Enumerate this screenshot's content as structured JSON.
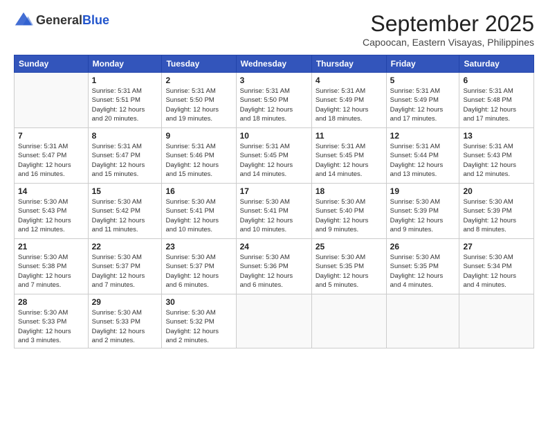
{
  "header": {
    "logo_general": "General",
    "logo_blue": "Blue",
    "month_title": "September 2025",
    "location": "Capoocan, Eastern Visayas, Philippines"
  },
  "days_of_week": [
    "Sunday",
    "Monday",
    "Tuesday",
    "Wednesday",
    "Thursday",
    "Friday",
    "Saturday"
  ],
  "weeks": [
    [
      {
        "day": "",
        "info": ""
      },
      {
        "day": "1",
        "info": "Sunrise: 5:31 AM\nSunset: 5:51 PM\nDaylight: 12 hours\nand 20 minutes."
      },
      {
        "day": "2",
        "info": "Sunrise: 5:31 AM\nSunset: 5:50 PM\nDaylight: 12 hours\nand 19 minutes."
      },
      {
        "day": "3",
        "info": "Sunrise: 5:31 AM\nSunset: 5:50 PM\nDaylight: 12 hours\nand 18 minutes."
      },
      {
        "day": "4",
        "info": "Sunrise: 5:31 AM\nSunset: 5:49 PM\nDaylight: 12 hours\nand 18 minutes."
      },
      {
        "day": "5",
        "info": "Sunrise: 5:31 AM\nSunset: 5:49 PM\nDaylight: 12 hours\nand 17 minutes."
      },
      {
        "day": "6",
        "info": "Sunrise: 5:31 AM\nSunset: 5:48 PM\nDaylight: 12 hours\nand 17 minutes."
      }
    ],
    [
      {
        "day": "7",
        "info": "Sunrise: 5:31 AM\nSunset: 5:47 PM\nDaylight: 12 hours\nand 16 minutes."
      },
      {
        "day": "8",
        "info": "Sunrise: 5:31 AM\nSunset: 5:47 PM\nDaylight: 12 hours\nand 15 minutes."
      },
      {
        "day": "9",
        "info": "Sunrise: 5:31 AM\nSunset: 5:46 PM\nDaylight: 12 hours\nand 15 minutes."
      },
      {
        "day": "10",
        "info": "Sunrise: 5:31 AM\nSunset: 5:45 PM\nDaylight: 12 hours\nand 14 minutes."
      },
      {
        "day": "11",
        "info": "Sunrise: 5:31 AM\nSunset: 5:45 PM\nDaylight: 12 hours\nand 14 minutes."
      },
      {
        "day": "12",
        "info": "Sunrise: 5:31 AM\nSunset: 5:44 PM\nDaylight: 12 hours\nand 13 minutes."
      },
      {
        "day": "13",
        "info": "Sunrise: 5:31 AM\nSunset: 5:43 PM\nDaylight: 12 hours\nand 12 minutes."
      }
    ],
    [
      {
        "day": "14",
        "info": "Sunrise: 5:30 AM\nSunset: 5:43 PM\nDaylight: 12 hours\nand 12 minutes."
      },
      {
        "day": "15",
        "info": "Sunrise: 5:30 AM\nSunset: 5:42 PM\nDaylight: 12 hours\nand 11 minutes."
      },
      {
        "day": "16",
        "info": "Sunrise: 5:30 AM\nSunset: 5:41 PM\nDaylight: 12 hours\nand 10 minutes."
      },
      {
        "day": "17",
        "info": "Sunrise: 5:30 AM\nSunset: 5:41 PM\nDaylight: 12 hours\nand 10 minutes."
      },
      {
        "day": "18",
        "info": "Sunrise: 5:30 AM\nSunset: 5:40 PM\nDaylight: 12 hours\nand 9 minutes."
      },
      {
        "day": "19",
        "info": "Sunrise: 5:30 AM\nSunset: 5:39 PM\nDaylight: 12 hours\nand 9 minutes."
      },
      {
        "day": "20",
        "info": "Sunrise: 5:30 AM\nSunset: 5:39 PM\nDaylight: 12 hours\nand 8 minutes."
      }
    ],
    [
      {
        "day": "21",
        "info": "Sunrise: 5:30 AM\nSunset: 5:38 PM\nDaylight: 12 hours\nand 7 minutes."
      },
      {
        "day": "22",
        "info": "Sunrise: 5:30 AM\nSunset: 5:37 PM\nDaylight: 12 hours\nand 7 minutes."
      },
      {
        "day": "23",
        "info": "Sunrise: 5:30 AM\nSunset: 5:37 PM\nDaylight: 12 hours\nand 6 minutes."
      },
      {
        "day": "24",
        "info": "Sunrise: 5:30 AM\nSunset: 5:36 PM\nDaylight: 12 hours\nand 6 minutes."
      },
      {
        "day": "25",
        "info": "Sunrise: 5:30 AM\nSunset: 5:35 PM\nDaylight: 12 hours\nand 5 minutes."
      },
      {
        "day": "26",
        "info": "Sunrise: 5:30 AM\nSunset: 5:35 PM\nDaylight: 12 hours\nand 4 minutes."
      },
      {
        "day": "27",
        "info": "Sunrise: 5:30 AM\nSunset: 5:34 PM\nDaylight: 12 hours\nand 4 minutes."
      }
    ],
    [
      {
        "day": "28",
        "info": "Sunrise: 5:30 AM\nSunset: 5:33 PM\nDaylight: 12 hours\nand 3 minutes."
      },
      {
        "day": "29",
        "info": "Sunrise: 5:30 AM\nSunset: 5:33 PM\nDaylight: 12 hours\nand 2 minutes."
      },
      {
        "day": "30",
        "info": "Sunrise: 5:30 AM\nSunset: 5:32 PM\nDaylight: 12 hours\nand 2 minutes."
      },
      {
        "day": "",
        "info": ""
      },
      {
        "day": "",
        "info": ""
      },
      {
        "day": "",
        "info": ""
      },
      {
        "day": "",
        "info": ""
      }
    ]
  ]
}
